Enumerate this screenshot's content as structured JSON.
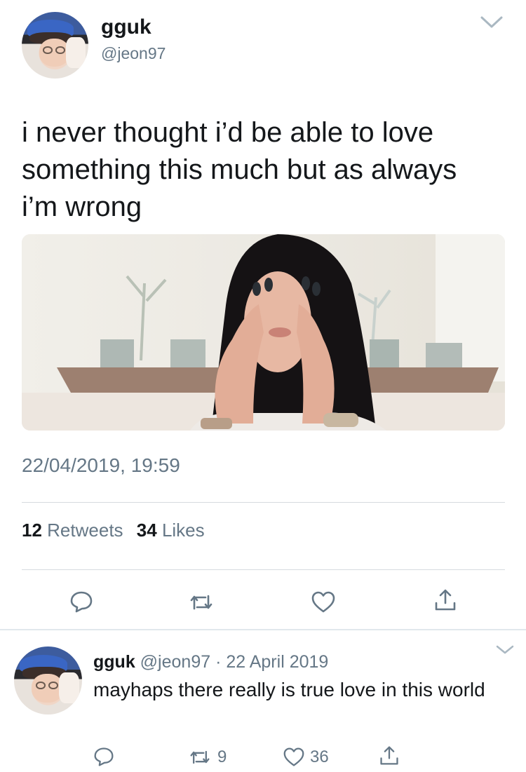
{
  "main_tweet": {
    "display_name": "gguk",
    "handle": "@jeon97",
    "text_lines": [
      "i never thought i’d be able to love",
      "something this much but as always",
      "i’m wrong"
    ],
    "timestamp": "22/04/2019, 19:59",
    "stats": {
      "retweets_count": "12",
      "retweets_label": "Retweets",
      "likes_count": "34",
      "likes_label": "Likes"
    },
    "icons": [
      "reply-icon",
      "retweet-icon",
      "like-icon",
      "share-icon"
    ]
  },
  "reply_tweet": {
    "display_name": "gguk",
    "handle": "@jeon97",
    "separator": "·",
    "date": "22 April 2019",
    "text": "mayhaps there really is true love in this world",
    "retweet_count": "9",
    "like_count": "36",
    "icons": [
      "reply-icon",
      "retweet-icon",
      "like-icon",
      "share-icon"
    ]
  },
  "colors": {
    "text_primary": "#14171a",
    "text_secondary": "#657786",
    "divider": "#d6dbdf",
    "icon": "#657786"
  }
}
